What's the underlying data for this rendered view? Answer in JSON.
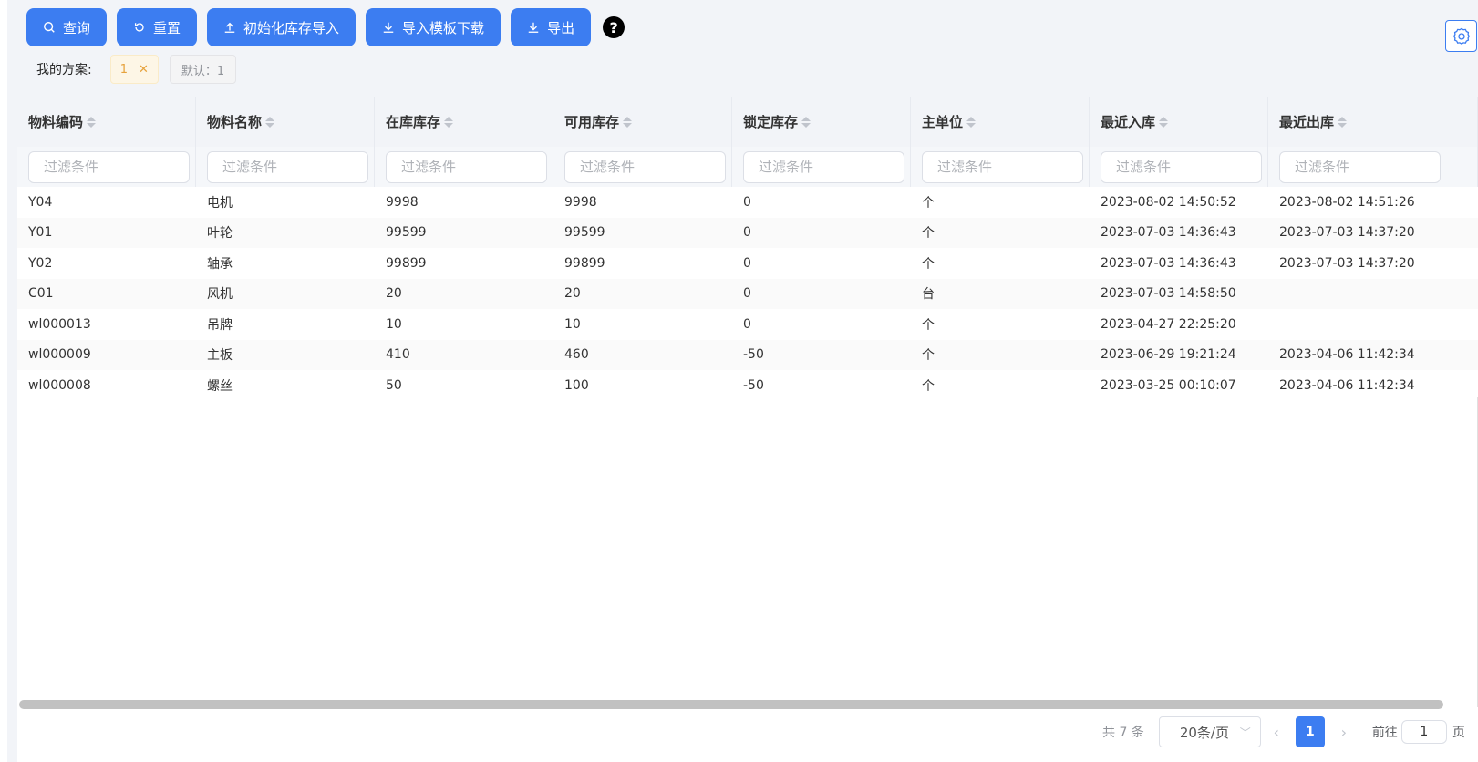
{
  "toolbar": {
    "query": "查询",
    "reset": "重置",
    "init_import": "初始化库存导入",
    "template_download": "导入模板下载",
    "export": "导出",
    "help": "?"
  },
  "scheme": {
    "label": "我的方案:",
    "active_tag": "1",
    "default_tag": "默认：1"
  },
  "table": {
    "columns": [
      "物料编码",
      "物料名称",
      "在库库存",
      "可用库存",
      "锁定库存",
      "主单位",
      "最近入库",
      "最近出库"
    ],
    "filter_placeholder": "过滤条件",
    "rows": [
      [
        "Y04",
        "电机",
        "9998",
        "9998",
        "0",
        "个",
        "2023-08-02 14:50:52",
        "2023-08-02 14:51:26"
      ],
      [
        "Y01",
        "叶轮",
        "99599",
        "99599",
        "0",
        "个",
        "2023-07-03 14:36:43",
        "2023-07-03 14:37:20"
      ],
      [
        "Y02",
        "轴承",
        "99899",
        "99899",
        "0",
        "个",
        "2023-07-03 14:36:43",
        "2023-07-03 14:37:20"
      ],
      [
        "C01",
        "风机",
        "20",
        "20",
        "0",
        "台",
        "2023-07-03 14:58:50",
        ""
      ],
      [
        "wl000013",
        "吊牌",
        "10",
        "10",
        "0",
        "个",
        "2023-04-27 22:25:20",
        ""
      ],
      [
        "wl000009",
        "主板",
        "410",
        "460",
        "-50",
        "个",
        "2023-06-29 19:21:24",
        "2023-04-06 11:42:34"
      ],
      [
        "wl000008",
        "螺丝",
        "50",
        "100",
        "-50",
        "个",
        "2023-03-25 00:10:07",
        "2023-04-06 11:42:34"
      ]
    ]
  },
  "pagination": {
    "total": "共 7 条",
    "page_size": "20条/页",
    "current_page": "1",
    "goto_label": "前往",
    "goto_value": "1",
    "goto_suffix": "页"
  },
  "colors": {
    "accent": "#3c7df1",
    "header_bg": "#f2f4f8"
  }
}
